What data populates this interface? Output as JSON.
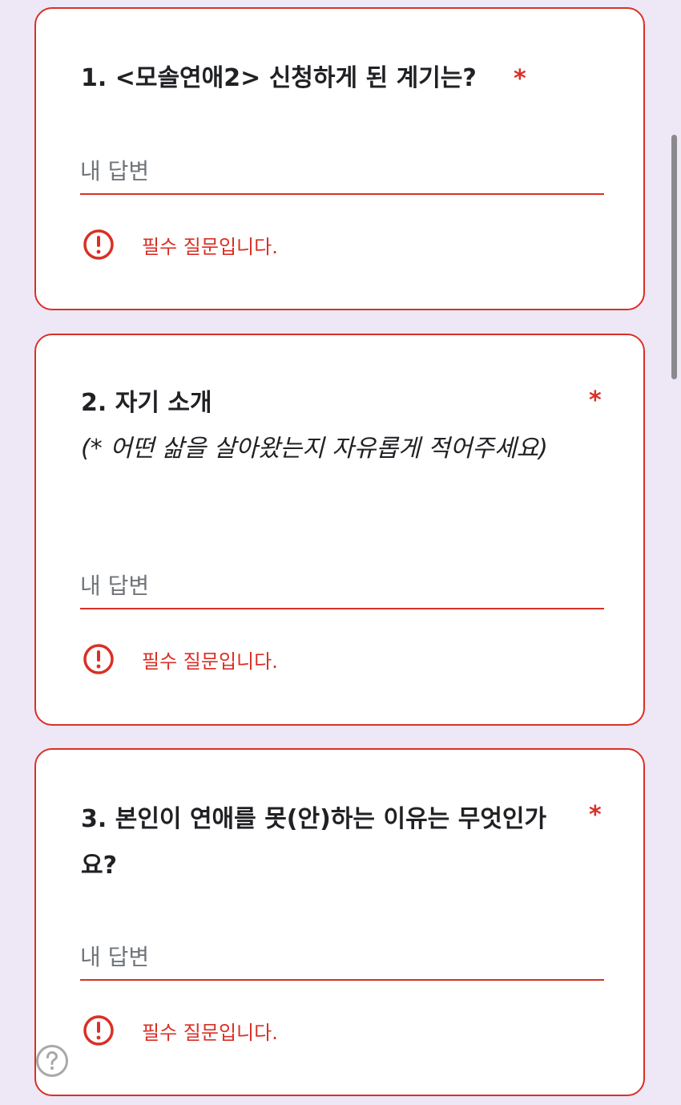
{
  "colors": {
    "background": "#ede7f6",
    "error": "#d93025",
    "text": "#202124",
    "placeholder": "#70757a"
  },
  "questions": [
    {
      "title": "1. <모솔연애2> 신청하게 된 계기는?",
      "required_mark": "*",
      "answer_placeholder": "내 답변",
      "error_text": "필수 질문입니다."
    },
    {
      "title": "2. 자기 소개",
      "description": "(* 어떤 삶을 살아왔는지 자유롭게 적어주세요)",
      "required_mark": "*",
      "answer_placeholder": "내 답변",
      "error_text": "필수 질문입니다."
    },
    {
      "title": "3. 본인이 연애를 못(안)하는 이유는 무엇인가요?",
      "required_mark": "*",
      "answer_placeholder": "내 답변",
      "error_text": "필수 질문입니다."
    }
  ],
  "icons": {
    "error": "error-circle-icon",
    "help": "help-circle-icon"
  }
}
